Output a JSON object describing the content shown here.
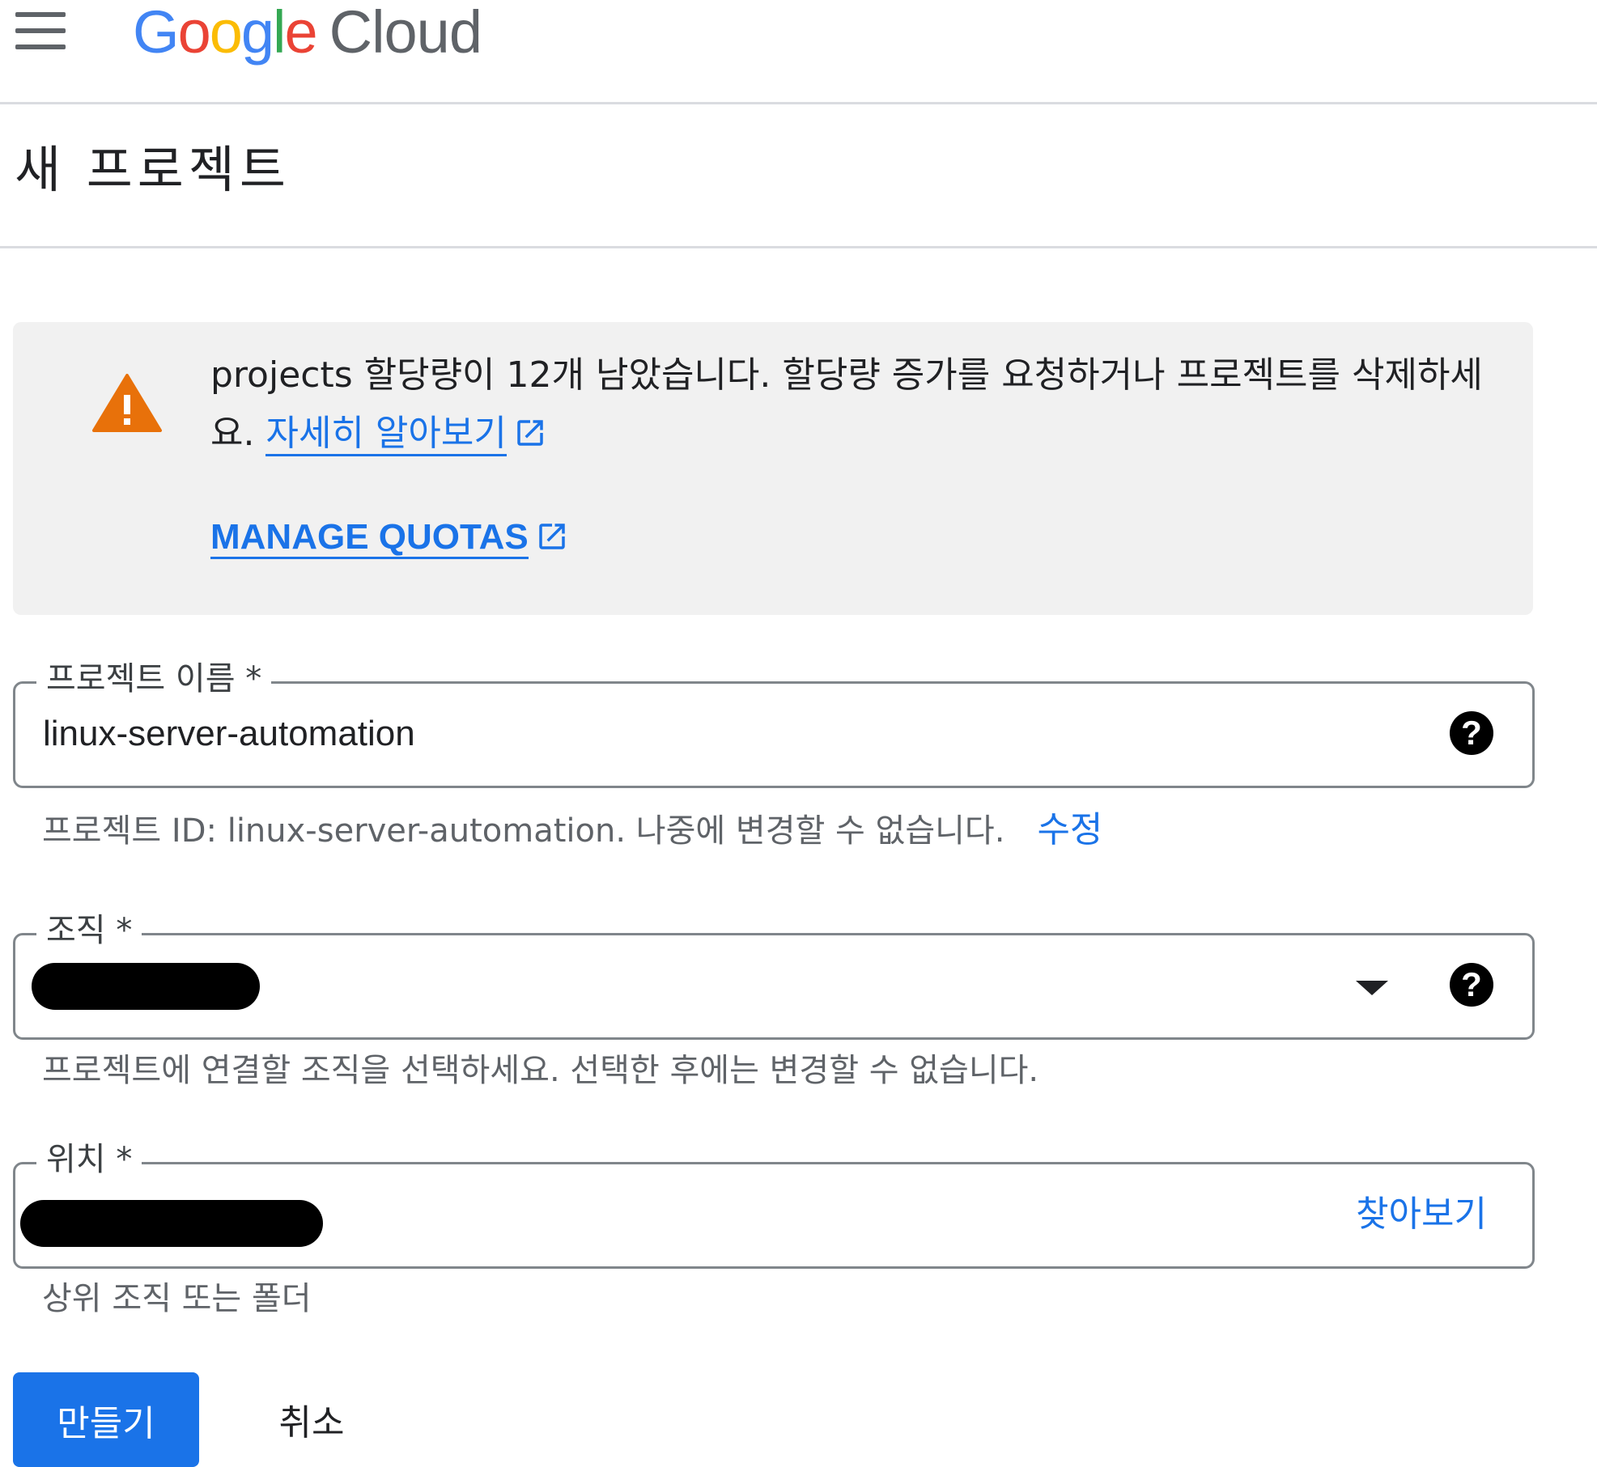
{
  "header": {
    "logo": {
      "letters": [
        "G",
        "o",
        "o",
        "g",
        "l",
        "e"
      ],
      "product": "Cloud",
      "colors": [
        "#4285f4",
        "#ea4335",
        "#fbbc05",
        "#4285f4",
        "#34a853",
        "#ea4335"
      ]
    }
  },
  "page": {
    "title": "새 프로젝트"
  },
  "warning": {
    "text": "projects 할당량이 12개 남았습니다. 할당량 증가를 요청하거나 프로젝트를 삭제하세요.",
    "learn_more_label": "자세히 알아보기",
    "manage_quotas_label": "MANAGE QUOTAS",
    "icon": "warning-icon",
    "icon_color": "#e8710a"
  },
  "form": {
    "project_name": {
      "label": "프로젝트 이름 *",
      "value": "linux-server-automation",
      "help_icon": "help-icon"
    },
    "project_id": {
      "helper": "프로젝트 ID: linux-server-automation. 나중에 변경할 수 없습니다.",
      "edit_label": "수정"
    },
    "organization": {
      "label": "조직 *",
      "helper": "프로젝트에 연결할 조직을 선택하세요. 선택한 후에는 변경할 수 없습니다."
    },
    "location": {
      "label": "위치 *",
      "browse_label": "찾아보기",
      "helper": "상위 조직 또는 폴더"
    }
  },
  "actions": {
    "create_label": "만들기",
    "cancel_label": "취소"
  },
  "colors": {
    "accent": "#1a73e8",
    "warning": "#e8710a",
    "callout_bg": "#f1f1f1",
    "border": "#80868b"
  }
}
